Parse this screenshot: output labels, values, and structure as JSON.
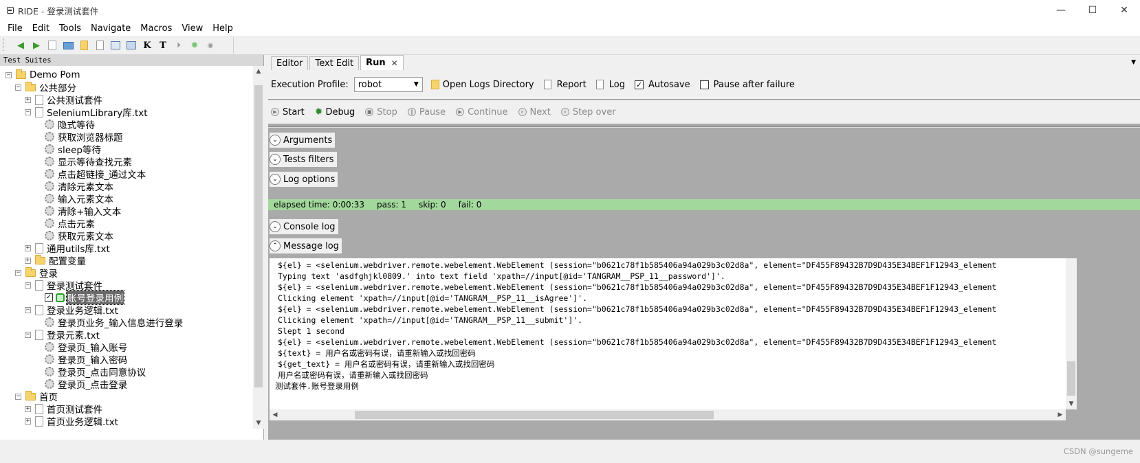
{
  "window": {
    "title": "RIDE - 登录测试套件",
    "minimize": "—",
    "maximize": "☐",
    "close": "✕"
  },
  "menu": [
    "File",
    "Edit",
    "Tools",
    "Navigate",
    "Macros",
    "View",
    "Help"
  ],
  "left_panel": {
    "header": "Test Suites"
  },
  "tree": [
    {
      "label": "Demo Pom",
      "icon": "folder",
      "level": 0,
      "expanded": true
    },
    {
      "label": "公共部分",
      "icon": "folder",
      "level": 1,
      "expanded": true
    },
    {
      "label": "公共测试套件",
      "icon": "page",
      "level": 2,
      "expanded": false
    },
    {
      "label": "SeleniumLibrary库.txt",
      "icon": "gear-page",
      "level": 2,
      "expanded": true
    },
    {
      "label": "隐式等待",
      "icon": "gear",
      "level": 3
    },
    {
      "label": "获取浏览器标题",
      "icon": "gear",
      "level": 3
    },
    {
      "label": "sleep等待",
      "icon": "gear",
      "level": 3
    },
    {
      "label": "显示等待查找元素",
      "icon": "gear",
      "level": 3
    },
    {
      "label": "点击超链接_通过文本",
      "icon": "gear",
      "level": 3
    },
    {
      "label": "清除元素文本",
      "icon": "gear",
      "level": 3
    },
    {
      "label": "输入元素文本",
      "icon": "gear",
      "level": 3
    },
    {
      "label": "清除+输入文本",
      "icon": "gear",
      "level": 3
    },
    {
      "label": "点击元素",
      "icon": "gear",
      "level": 3
    },
    {
      "label": "获取元素文本",
      "icon": "gear",
      "level": 3
    },
    {
      "label": "通用utils库.txt",
      "icon": "gear-page",
      "level": 2,
      "expanded": false
    },
    {
      "label": "配置变量",
      "icon": "folder",
      "level": 2,
      "expanded": false
    },
    {
      "label": "登录",
      "icon": "folder",
      "level": 1,
      "expanded": true
    },
    {
      "label": "登录测试套件",
      "icon": "page",
      "level": 2,
      "expanded": true
    },
    {
      "label": "账号登录用例",
      "icon": "testcase",
      "level": 3,
      "selected": true
    },
    {
      "label": "登录业务逻辑.txt",
      "icon": "gear-page",
      "level": 2,
      "expanded": true
    },
    {
      "label": "登录页业务_输入信息进行登录",
      "icon": "gear",
      "level": 3
    },
    {
      "label": "登录元素.txt",
      "icon": "gear-page",
      "level": 2,
      "expanded": true
    },
    {
      "label": "登录页_输入账号",
      "icon": "gear",
      "level": 3
    },
    {
      "label": "登录页_输入密码",
      "icon": "gear",
      "level": 3
    },
    {
      "label": "登录页_点击同意协议",
      "icon": "gear",
      "level": 3
    },
    {
      "label": "登录页_点击登录",
      "icon": "gear",
      "level": 3
    },
    {
      "label": "首页",
      "icon": "folder",
      "level": 1,
      "expanded": true
    },
    {
      "label": "首页测试套件",
      "icon": "page",
      "level": 2,
      "expanded": false
    },
    {
      "label": "首页业务逻辑.txt",
      "icon": "gear-page",
      "level": 2,
      "expanded": false
    }
  ],
  "tabs": [
    {
      "label": "Editor"
    },
    {
      "label": "Text Edit"
    },
    {
      "label": "Run",
      "active": true
    }
  ],
  "profile": {
    "label": "Execution Profile:",
    "value": "robot",
    "open_logs": "Open Logs Directory",
    "report": "Report",
    "log": "Log",
    "autosave": "Autosave",
    "pause": "Pause after failure"
  },
  "run_buttons": [
    {
      "label": "Start",
      "enabled": true
    },
    {
      "label": "Debug",
      "enabled": true
    },
    {
      "label": "Stop",
      "enabled": false
    },
    {
      "label": "Pause",
      "enabled": false
    },
    {
      "label": "Continue",
      "enabled": false
    },
    {
      "label": "Next",
      "enabled": false
    },
    {
      "label": "Step over",
      "enabled": false
    }
  ],
  "sections": {
    "arguments": "Arguments",
    "tests_filters": "Tests filters",
    "log_options": "Log options",
    "console_log": "Console log",
    "message_log": "Message log"
  },
  "status": {
    "elapsed": "elapsed time: 0:00:33",
    "pass": "pass: 1",
    "skip": "skip: 0",
    "fail": "fail: 0",
    "color": "#a2d89c"
  },
  "log_lines": [
    "${el} = <selenium.webdriver.remote.webelement.WebElement (session=\"b0621c78f1b585406a94a029b3c02d8a\", element=\"DF455F89432B7D9D435E34BEF1F12943_element",
    "Typing text 'asdfghjkl0809.' into text field 'xpath=//input[@id='TANGRAM__PSP_11__password']'.",
    "${el} = <selenium.webdriver.remote.webelement.WebElement (session=\"b0621c78f1b585406a94a029b3c02d8a\", element=\"DF455F89432B7D9D435E34BEF1F12943_element",
    "Clicking element 'xpath=//input[@id='TANGRAM__PSP_11__isAgree']'.",
    "${el} = <selenium.webdriver.remote.webelement.WebElement (session=\"b0621c78f1b585406a94a029b3c02d8a\", element=\"DF455F89432B7D9D435E34BEF1F12943_element",
    "Clicking element 'xpath=//input[@id='TANGRAM__PSP_11__submit']'.",
    "Slept 1 second",
    "${el} = <selenium.webdriver.remote.webelement.WebElement (session=\"b0621c78f1b585406a94a029b3c02d8a\", element=\"DF455F89432B7D9D435E34BEF1F12943_element",
    "${text} = 用户名或密码有误，请重新输入或找回密码",
    "${get_text} = 用户名或密码有误，请重新输入或找回密码",
    " 用户名或密码有误，请重新输入或找回密码",
    "测试套件.账号登录用例"
  ],
  "watermark": "CSDN @sungeme"
}
